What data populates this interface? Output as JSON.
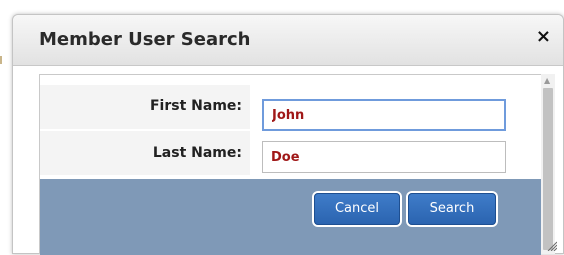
{
  "dialog": {
    "title": "Member User Search",
    "close_icon": "close-icon",
    "close_glyph": "×"
  },
  "form": {
    "first_name_label": "First Name:",
    "first_name_value": "John",
    "last_name_label": "Last Name:",
    "last_name_value": "Doe"
  },
  "buttons": {
    "cancel_label": "Cancel",
    "search_label": "Search"
  },
  "colors": {
    "button_bar": "#7f99b7",
    "button": "#2f6bb8",
    "input_text": "#a01818",
    "focus_border": "#6f9bdc"
  }
}
